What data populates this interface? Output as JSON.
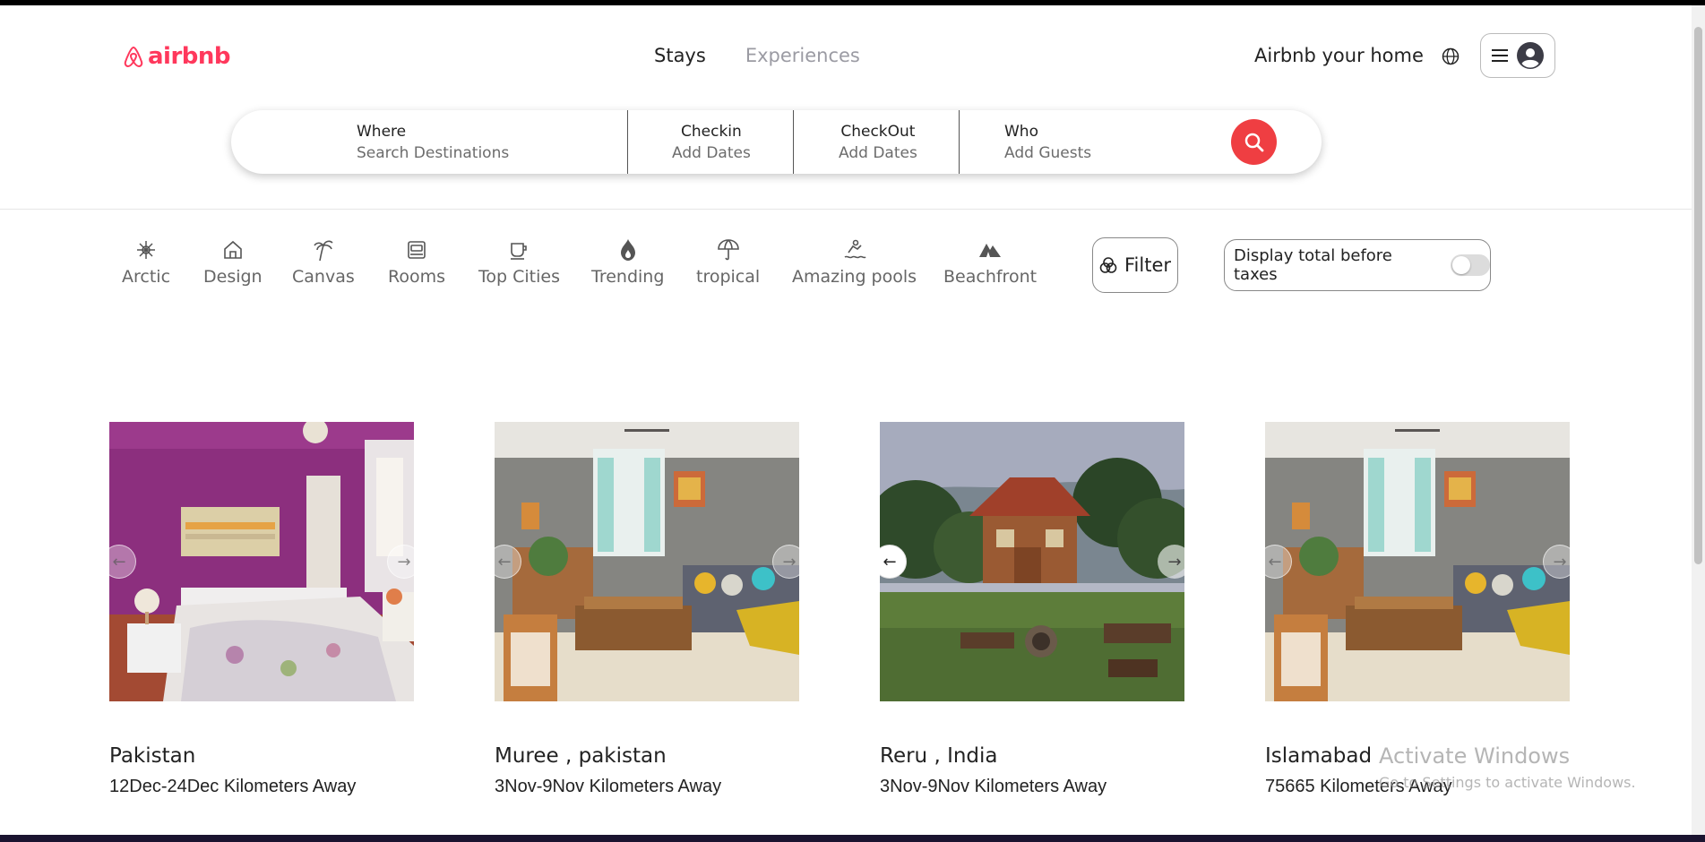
{
  "header": {
    "logo_text": "airbnb",
    "tabs": [
      "Stays",
      "Experiences"
    ],
    "host_link": "Airbnb your home"
  },
  "search": {
    "where": {
      "label": "Where",
      "placeholder": "Search Destinations"
    },
    "checkin": {
      "label": "Checkin",
      "placeholder": "Add Dates"
    },
    "checkout": {
      "label": "CheckOut",
      "placeholder": "Add Dates"
    },
    "who": {
      "label": "Who",
      "placeholder": "Add Guests"
    }
  },
  "categories": [
    {
      "label": "Arctic",
      "icon": "snowflake-icon"
    },
    {
      "label": "Design",
      "icon": "house-icon"
    },
    {
      "label": "Canvas",
      "icon": "palm-tree-icon"
    },
    {
      "label": "Rooms",
      "icon": "bed-icon"
    },
    {
      "label": "Top Cities",
      "icon": "cup-icon"
    },
    {
      "label": "Trending",
      "icon": "flame-icon"
    },
    {
      "label": "tropical",
      "icon": "umbrella-icon"
    },
    {
      "label": "Amazing pools",
      "icon": "swimmer-icon"
    },
    {
      "label": "Beachfront",
      "icon": "tent-icon"
    }
  ],
  "filter_label": "Filter",
  "tax_toggle_label": "Display total before taxes",
  "listings": [
    {
      "title": "Pakistan",
      "subtitle": "12Dec-24Dec Kilometers Away",
      "photo": "purple-bedroom"
    },
    {
      "title": "Muree , pakistan",
      "subtitle": "3Nov-9Nov Kilometers Away",
      "photo": "living-room"
    },
    {
      "title": "Reru , India",
      "subtitle": "3Nov-9Nov Kilometers Away",
      "photo": "wooden-cabin"
    },
    {
      "title": "Islamabad",
      "subtitle": "75665 Kilometers Away",
      "photo": "living-room"
    }
  ],
  "watermark": {
    "title": "Activate Windows",
    "subtitle": "Go to Settings to activate Windows."
  },
  "colors": {
    "brand": "#ff385c",
    "search_button": "#ef3e42"
  }
}
